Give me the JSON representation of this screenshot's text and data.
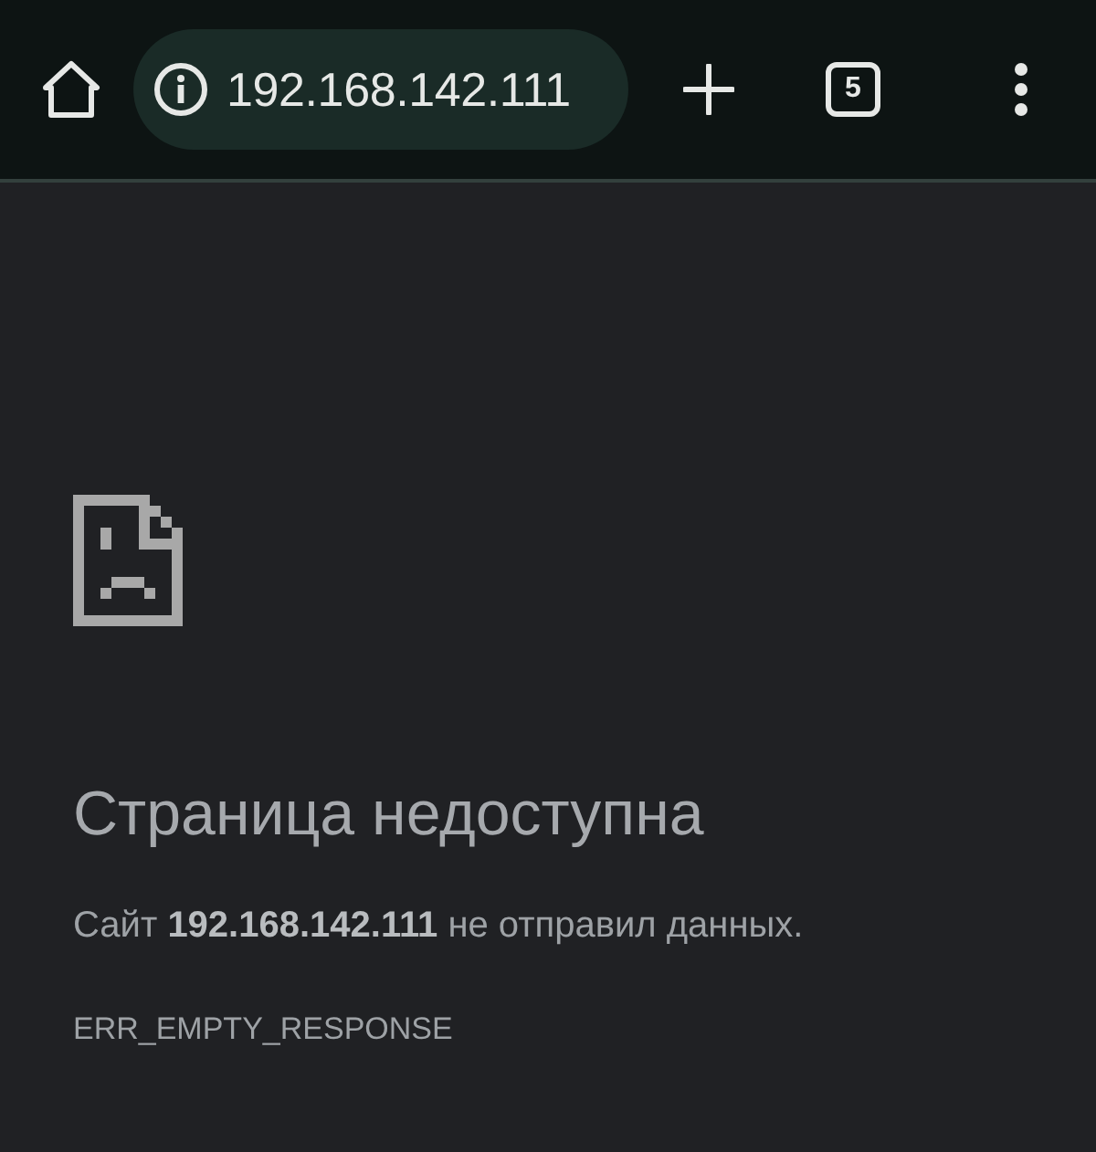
{
  "toolbar": {
    "url": "192.168.142.111",
    "tab_count": "5"
  },
  "error": {
    "title": "Страница недоступна",
    "message": "Сайт **192.168.142.111** не отправил данных.",
    "code": "ERR_EMPTY_RESPONSE"
  }
}
